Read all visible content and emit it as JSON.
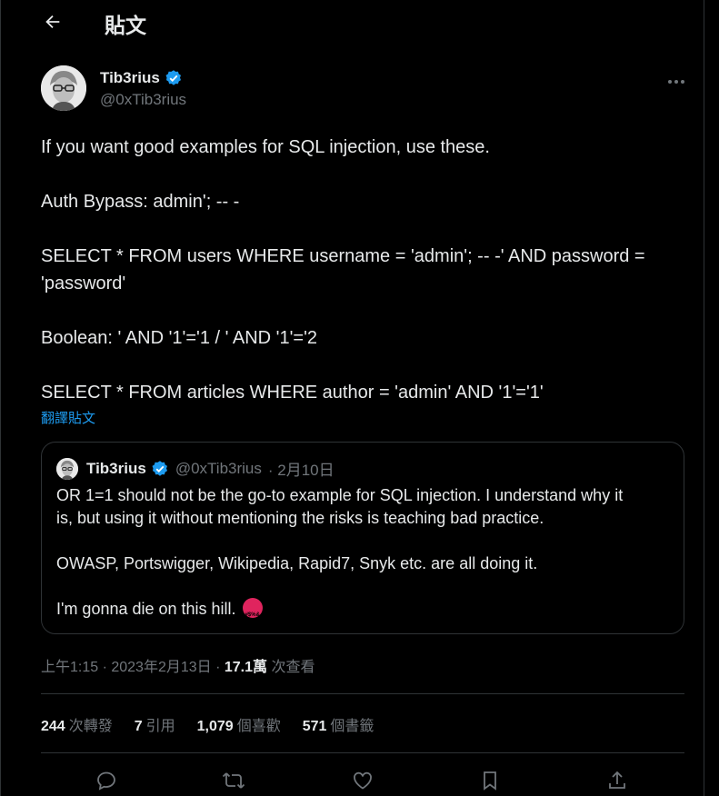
{
  "header": {
    "title": "貼文"
  },
  "author": {
    "name": "Tib3rius",
    "handle": "@0xTib3rius"
  },
  "tweet": {
    "lines": [
      "If you want good examples for SQL injection, use these.",
      "",
      "Auth Bypass: admin'; -- -",
      "",
      "SELECT * FROM users WHERE username = 'admin'; -- -' AND password =",
      "'password'",
      "",
      "Boolean: ' AND '1'='1 / ' AND '1'='2",
      "",
      "SELECT * FROM articles WHERE author = 'admin' AND '1'='1'"
    ],
    "translate_label": "翻譯貼文"
  },
  "quote": {
    "name": "Tib3rius",
    "handle": "@0xTib3rius",
    "date": "· 2月10日",
    "line1": "OR 1=1 should not be the go-to example for SQL injection. I understand why it",
    "line2": "is, but using it without mentioning the risks is teaching bad practice.",
    "line3": "OWASP, Portswigger, Wikipedia, Rapid7, Snyk etc. are all doing it.",
    "line4": "I'm gonna die on this hill."
  },
  "meta": {
    "time": "上午1:15 · 2023年2月13日 · ",
    "views": "17.1萬",
    "views_label": " 次查看"
  },
  "stats": [
    {
      "count": "244",
      "label": "次轉發"
    },
    {
      "count": "7",
      "label": "引用"
    },
    {
      "count": "1,079",
      "label": "個喜歡"
    },
    {
      "count": "571",
      "label": "個書籤"
    }
  ],
  "colors": {
    "accent": "#1d9bf0",
    "verified": "#1d9bf0",
    "muted": "#71767b",
    "text": "#e7e9ea",
    "border": "#2f3336"
  }
}
